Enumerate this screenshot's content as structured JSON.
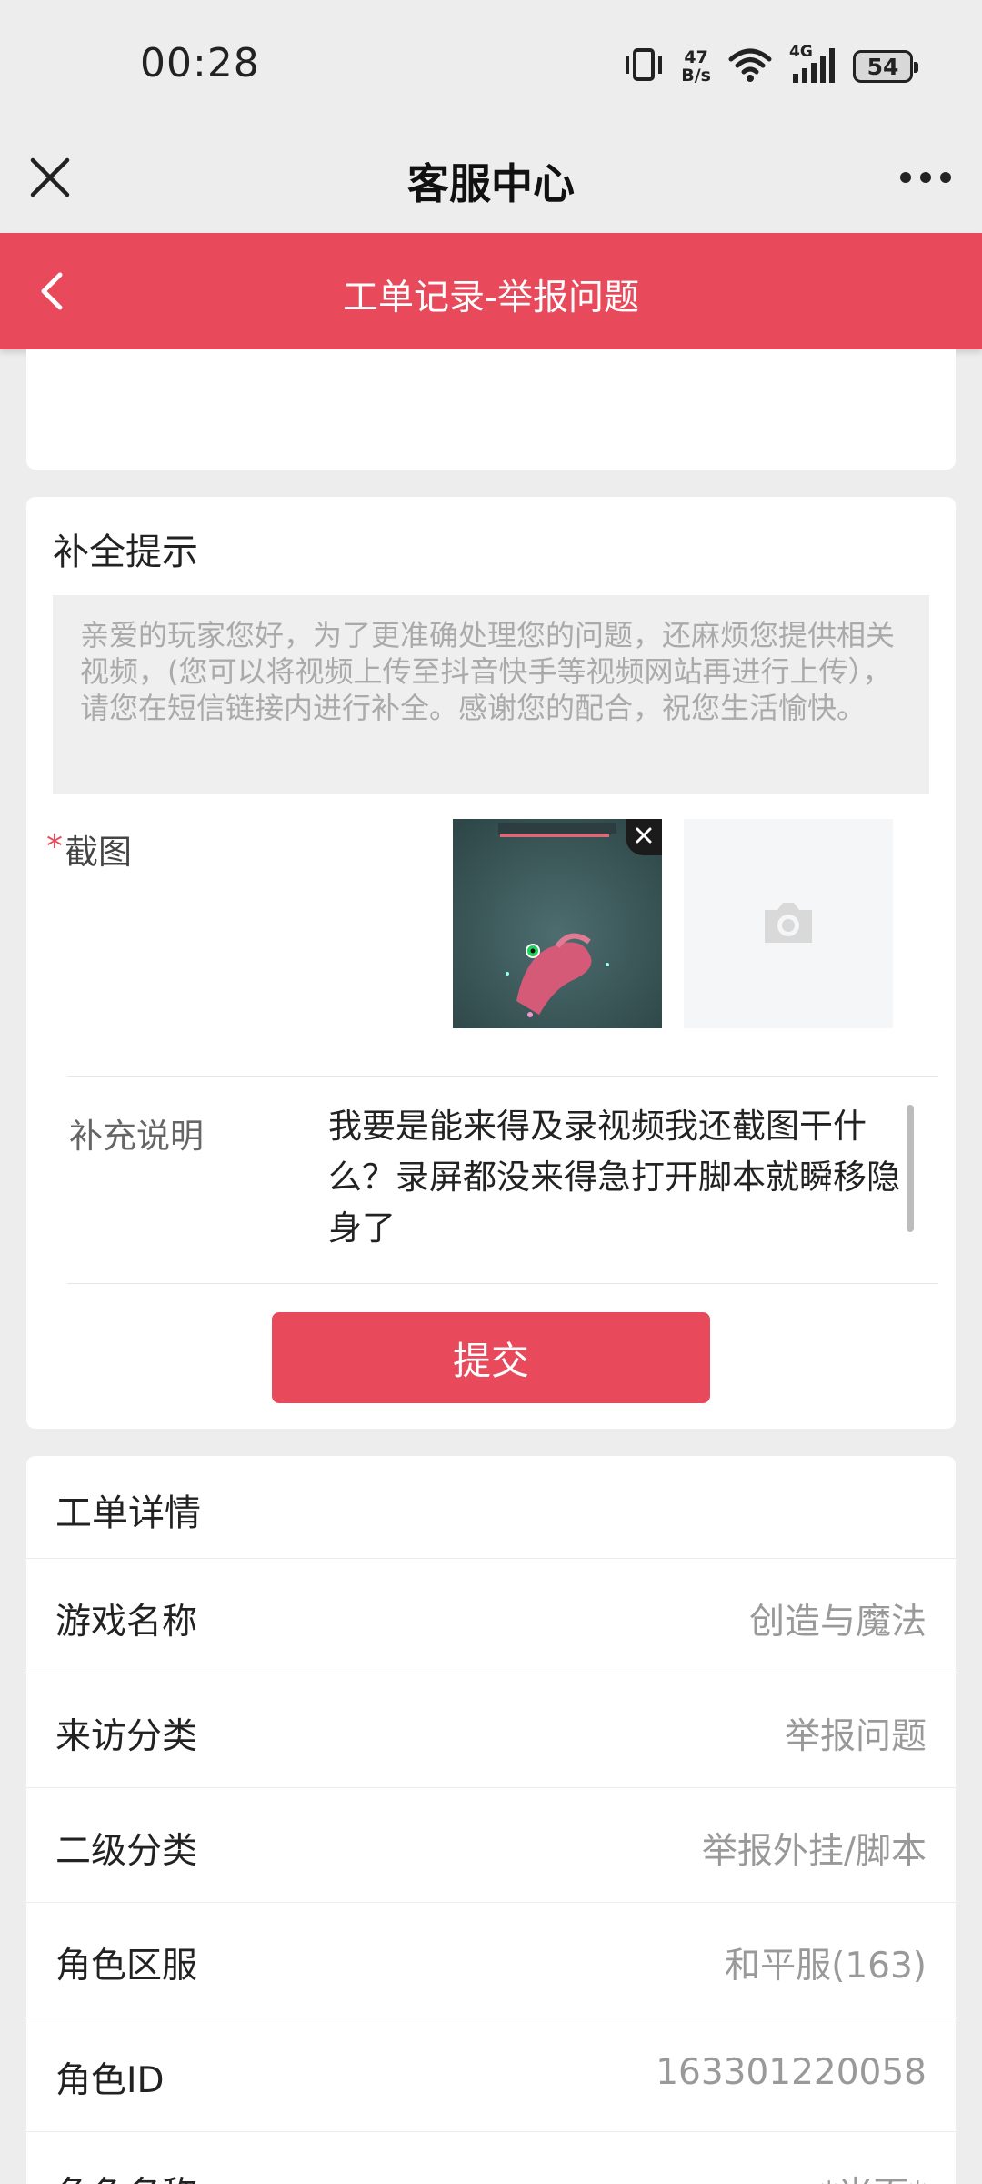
{
  "status_bar": {
    "time": "00:28",
    "net_speed_value": "47",
    "net_speed_unit": "B/s",
    "network_type": "4G",
    "battery": "54"
  },
  "title_bar": {
    "title": "客服中心"
  },
  "header": {
    "title": "工单记录-举报问题"
  },
  "supplement": {
    "title": "补全提示",
    "hint": "亲爱的玩家您好，为了更准确处理您的问题，还麻烦您提供相关视频，(您可以将视频上传至抖音快手等视频网站再进行上传），请您在短信链接内进行补全。感谢您的配合，祝您生活愉快。",
    "required_mark": "*",
    "screenshot_label": "截图",
    "description_label": "补充说明",
    "description_value": "我要是能来得及录视频我还截图干什么？录屏都没来得急打开脚本就瞬移隐身了",
    "submit_label": "提交"
  },
  "detail": {
    "title": "工单详情",
    "rows": [
      {
        "key": "游戏名称",
        "value": "创造与魔法"
      },
      {
        "key": "来访分类",
        "value": "举报问题"
      },
      {
        "key": "二级分类",
        "value": "举报外挂/脚本"
      },
      {
        "key": "角色区服",
        "value": "和平服(163)"
      },
      {
        "key": "角色ID",
        "value": "163301220058"
      },
      {
        "key": "角色名称",
        "value": "*米面*"
      }
    ]
  },
  "colors": {
    "accent": "#e84a5c",
    "background": "#ededed"
  }
}
